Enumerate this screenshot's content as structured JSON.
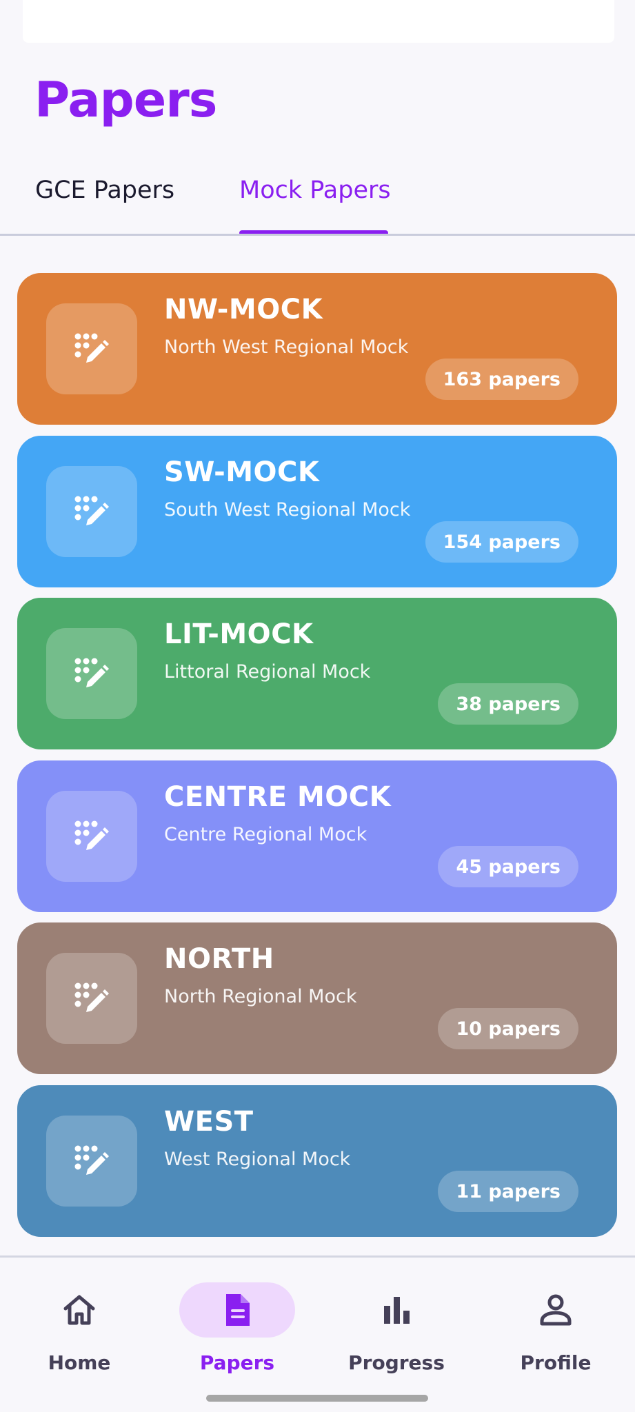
{
  "header": {
    "title": "Papers"
  },
  "tabs": [
    {
      "label": "GCE Papers",
      "active": false
    },
    {
      "label": "Mock Papers",
      "active": true
    }
  ],
  "mocks": [
    {
      "name": "NW-MOCK",
      "description": "North West Regional Mock",
      "count": "163 papers",
      "color": "#de7e37",
      "icon": "pencil-dots-icon"
    },
    {
      "name": "SW-MOCK",
      "description": "South West Regional Mock",
      "count": "154 papers",
      "color": "#44a6f5",
      "icon": "pencil-dots-icon"
    },
    {
      "name": "LIT-MOCK",
      "description": "Littoral Regional Mock",
      "count": "38 papers",
      "color": "#4dab6b",
      "icon": "pencil-dots-icon"
    },
    {
      "name": "CENTRE MOCK",
      "description": "Centre Regional Mock",
      "count": "45 papers",
      "color": "#8490f8",
      "icon": "pencil-dots-icon"
    },
    {
      "name": "NORTH",
      "description": "North Regional Mock",
      "count": "10 papers",
      "color": "#9b8075",
      "icon": "pencil-dots-icon"
    },
    {
      "name": "WEST",
      "description": "West Regional Mock",
      "count": "11 papers",
      "color": "#4e8bba",
      "icon": "pencil-dots-icon"
    }
  ],
  "bottom_nav": [
    {
      "label": "Home",
      "icon": "home-icon",
      "active": false
    },
    {
      "label": "Papers",
      "icon": "document-icon",
      "active": true
    },
    {
      "label": "Progress",
      "icon": "bar-chart-icon",
      "active": false
    },
    {
      "label": "Profile",
      "icon": "person-icon",
      "active": false
    }
  ],
  "colors": {
    "accent": "#8a1ff0",
    "nav_active_bg": "#eed8fd",
    "nav_text": "#454058"
  }
}
